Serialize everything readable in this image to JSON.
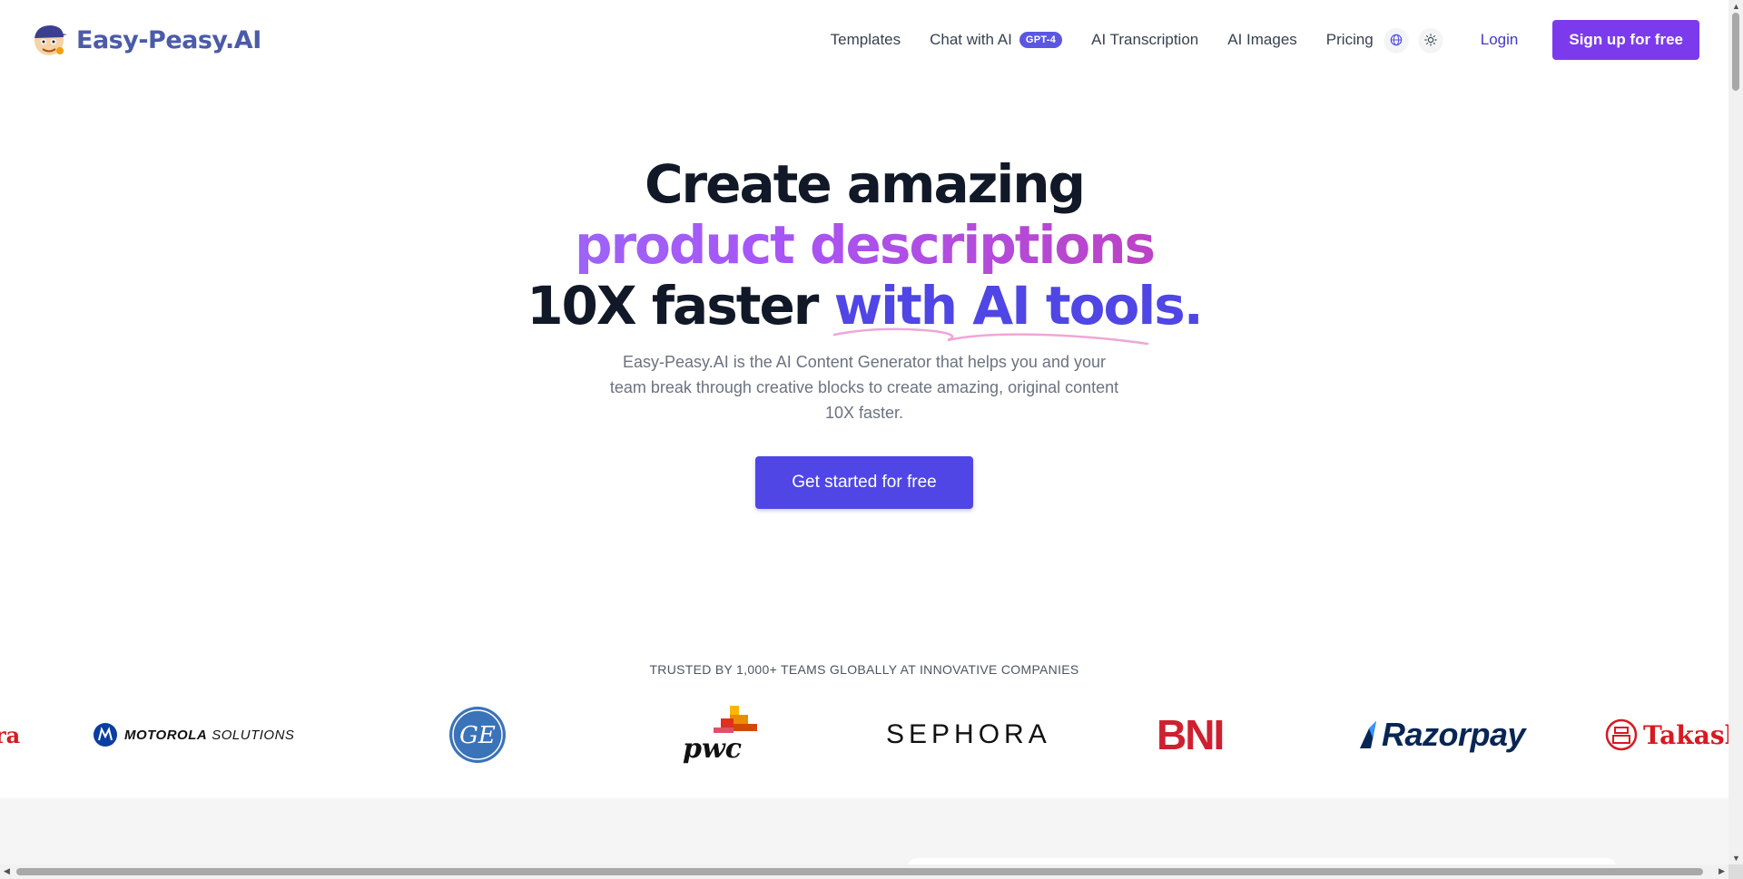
{
  "header": {
    "brand": "Easy-Peasy.AI",
    "nav": {
      "templates": "Templates",
      "chat": "Chat with AI",
      "chat_badge": "GPT-4",
      "transcription": "AI Transcription",
      "images": "AI Images",
      "pricing": "Pricing"
    },
    "icons": [
      "globe-icon",
      "sun-icon"
    ],
    "login": "Login",
    "signup": "Sign up for free"
  },
  "hero": {
    "line1": "Create amazing",
    "line2": "product descriptions",
    "line3_dark": "10X faster ",
    "line3_blue": "with AI tools.",
    "subtitle": "Easy-Peasy.AI is the AI Content Generator that helps you and your team break through creative blocks to create amazing, original content 10X faster.",
    "cta": "Get started for free"
  },
  "trusted": {
    "heading": "TRUSTED BY 1,000+ TEAMS GLOBALLY AT INNOVATIVE COMPANIES",
    "logos": {
      "partial_left": "ra",
      "motorola": "MOTOROLA",
      "motorola_suffix": "SOLUTIONS",
      "ge": "GE",
      "pwc": "pwc",
      "sephora": "SEPHORA",
      "bni": "BNI",
      "razorpay": "Razorpay",
      "takashimaya": "Takashi"
    }
  },
  "colors": {
    "brand": "#4b5ba8",
    "primary": "#4f46e5",
    "signup": "#7c3aed",
    "headline": "#111827"
  }
}
